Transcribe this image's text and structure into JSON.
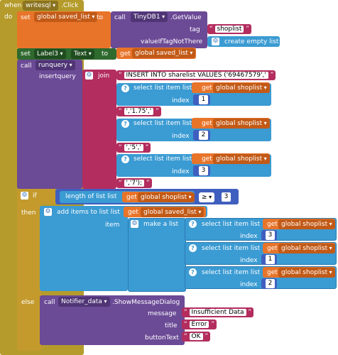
{
  "event": {
    "when_label": "when",
    "component": "writesql",
    "event_name": ".Click",
    "do_label": "do"
  },
  "set1": {
    "set_label": "set",
    "variable": "global saved_list",
    "to_label": "to",
    "call_label": "call",
    "component": "TinyDB1",
    "method": ".GetValue",
    "tag_label": "tag",
    "tag_value": "shoplist",
    "value_if_label": "valueIfTagNotThere",
    "value_if_text": "create empty list"
  },
  "set2": {
    "set_label": "set",
    "component": "Label3",
    "property": "Text",
    "to_label": "to",
    "get_label": "get",
    "variable": "global saved_list"
  },
  "runquery": {
    "call_label": "call",
    "procedure": "runquery",
    "param_label": "insertquery",
    "join_label": "join",
    "strings": [
      "INSERT INTO sharelist VALUES ('69467579','",
      "','1.75','",
      "','5','",
      "','7');"
    ],
    "select_label": "select list item  list",
    "index_label": "index",
    "get_label": "get",
    "variable": "global shoplist",
    "indexes": [
      "1",
      "2",
      "3"
    ]
  },
  "if_block": {
    "if_label": "if",
    "length_label": "length of list  list",
    "get_label": "get",
    "variable": "global shoplist",
    "operator": "≥",
    "compare_value": "3",
    "then_label": "then",
    "else_label": "else"
  },
  "add_items": {
    "label": "add items to list  list",
    "get_label": "get",
    "variable": "global saved_list",
    "item_label": "item",
    "make_list_label": "make a list",
    "select_label": "select list item  list",
    "index_label": "index",
    "list_variable": "global shoplist",
    "indexes": [
      "3",
      "1",
      "2"
    ]
  },
  "notifier": {
    "call_label": "call",
    "component": "Notifier_data",
    "method": ".ShowMessageDialog",
    "message_label": "message",
    "message_value": "Insufficient Data",
    "title_label": "title",
    "title_value": "Error",
    "button_label": "buttonText",
    "button_value": "OK"
  },
  "colors": {
    "event": "#b59b2b",
    "variables": "#e8742a",
    "tinydb": "#6b4a96",
    "label": "#2f6a2e",
    "procedure": "#6b4a96",
    "text": "#b32d5e",
    "lists": "#3b9bd3",
    "control": "#c49a2c",
    "math": "#3f5fbf"
  }
}
